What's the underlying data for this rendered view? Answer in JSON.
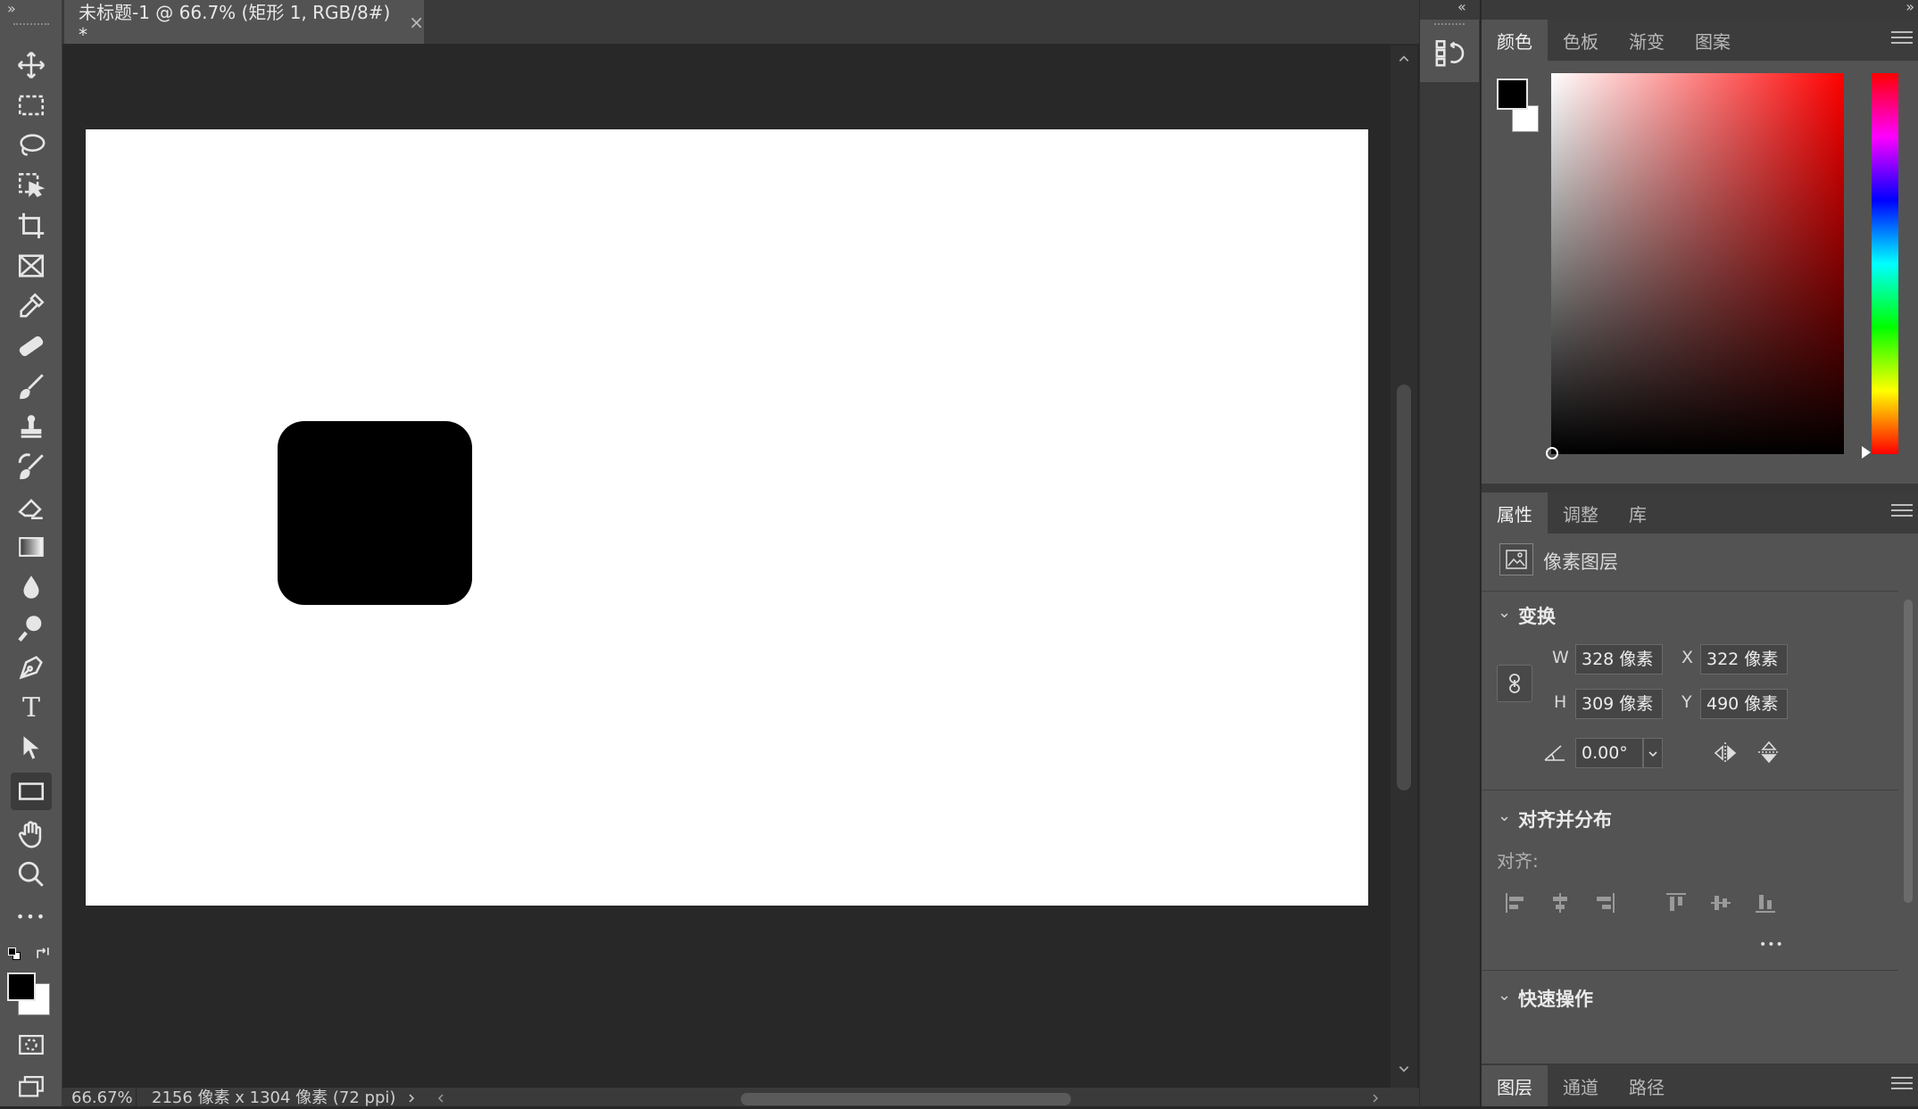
{
  "document": {
    "tab_title": "未标题-1 @ 66.7% (矩形 1, RGB/8#) *",
    "close_glyph": "×"
  },
  "status": {
    "zoom": "66.67%",
    "doc_info": "2156 像素 x 1304 像素 (72 ppi)"
  },
  "toolbar": {
    "tools": [
      {
        "name": "move-tool",
        "icon": "move-icon"
      },
      {
        "name": "marquee-tool",
        "icon": "rect-marquee-icon"
      },
      {
        "name": "lasso-tool",
        "icon": "lasso-icon"
      },
      {
        "name": "object-select-tool",
        "icon": "object-select-icon"
      },
      {
        "name": "crop-tool",
        "icon": "crop-icon"
      },
      {
        "name": "frame-tool",
        "icon": "frame-icon"
      },
      {
        "name": "eyedropper-tool",
        "icon": "eyedropper-icon"
      },
      {
        "name": "healing-tool",
        "icon": "bandage-icon"
      },
      {
        "name": "brush-tool",
        "icon": "brush-icon"
      },
      {
        "name": "stamp-tool",
        "icon": "stamp-icon"
      },
      {
        "name": "history-brush-tool",
        "icon": "history-brush-icon"
      },
      {
        "name": "eraser-tool",
        "icon": "eraser-icon"
      },
      {
        "name": "gradient-tool",
        "icon": "gradient-icon"
      },
      {
        "name": "blur-tool",
        "icon": "drop-icon"
      },
      {
        "name": "dodge-tool",
        "icon": "dodge-icon"
      },
      {
        "name": "pen-tool",
        "icon": "pen-icon"
      },
      {
        "name": "type-tool",
        "icon": "type-icon"
      },
      {
        "name": "path-select-tool",
        "icon": "arrow-icon"
      },
      {
        "name": "rectangle-tool",
        "icon": "rectangle-icon"
      },
      {
        "name": "hand-tool",
        "icon": "hand-icon"
      },
      {
        "name": "zoom-tool",
        "icon": "zoom-icon"
      },
      {
        "name": "more-tools",
        "icon": "ellipsis-icon"
      }
    ],
    "active_tool": "rectangle-tool",
    "foreground_color": "#000000",
    "background_color": "#ffffff",
    "type_glyph": "T",
    "ellipsis_glyph": "•••"
  },
  "collapse_left_glyph": "»",
  "collapse_right_glyph": "«",
  "color_panel": {
    "tabs": [
      "颜色",
      "色板",
      "渐变",
      "图案"
    ],
    "active_tab": "颜色",
    "hue_color": "#ff0000"
  },
  "properties_panel": {
    "tabs": [
      "属性",
      "调整",
      "库"
    ],
    "active_tab": "属性",
    "layer_type": "像素图层",
    "transform": {
      "title": "变换",
      "w_label": "W",
      "w_value": "328 像素",
      "h_label": "H",
      "h_value": "309 像素",
      "x_label": "X",
      "x_value": "322 像素",
      "y_label": "Y",
      "y_value": "490 像素",
      "angle_value": "0.00°"
    },
    "align": {
      "title": "对齐并分布",
      "label": "对齐:"
    },
    "quick_actions": {
      "title": "快速操作"
    }
  },
  "layers_panel": {
    "tabs": [
      "图层",
      "通道",
      "路径"
    ],
    "active_tab": "图层"
  }
}
